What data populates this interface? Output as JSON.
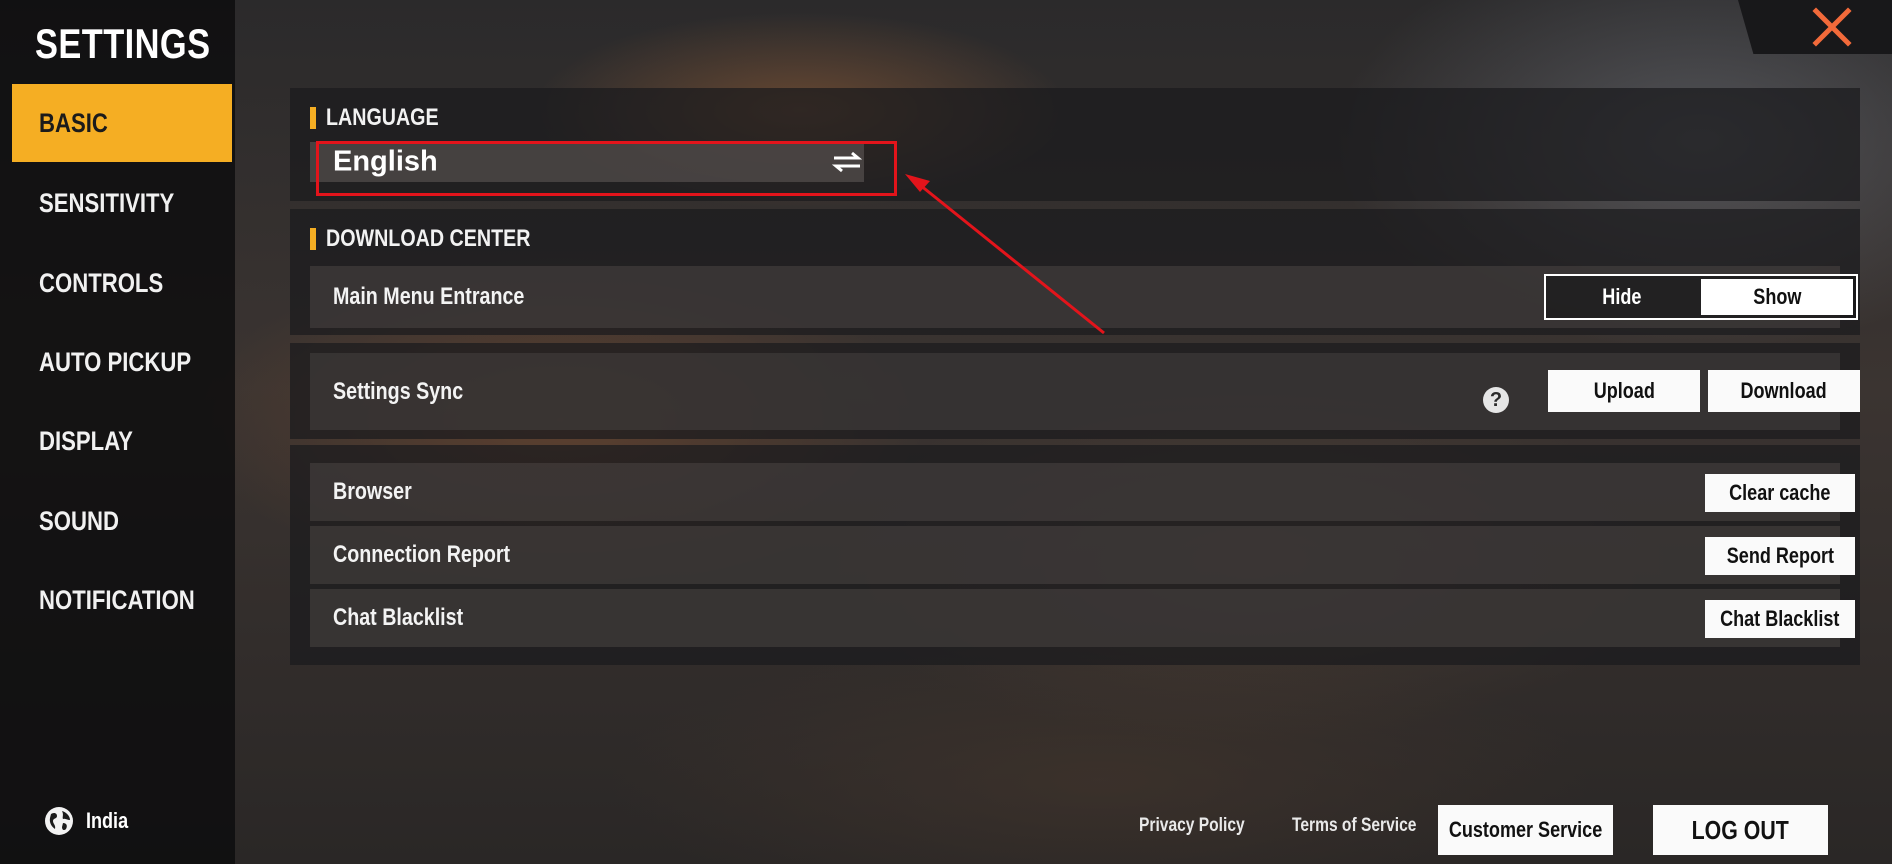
{
  "sidebar": {
    "title": "SETTINGS",
    "items": [
      {
        "label": "BASIC",
        "active": true
      },
      {
        "label": "SENSITIVITY",
        "active": false
      },
      {
        "label": "CONTROLS",
        "active": false
      },
      {
        "label": "AUTO PICKUP",
        "active": false
      },
      {
        "label": "DISPLAY",
        "active": false
      },
      {
        "label": "SOUND",
        "active": false
      },
      {
        "label": "NOTIFICATION",
        "active": false
      }
    ],
    "region": "India"
  },
  "language": {
    "section_label": "LANGUAGE",
    "value": "English"
  },
  "download_center": {
    "section_label": "DOWNLOAD CENTER",
    "row_label": "Main Menu Entrance",
    "options": [
      "Hide",
      "Show"
    ],
    "selected": "Show"
  },
  "sync": {
    "label": "Settings Sync",
    "help_glyph": "?",
    "upload_label": "Upload",
    "download_label": "Download"
  },
  "misc_rows": [
    {
      "label": "Browser",
      "button": "Clear cache"
    },
    {
      "label": "Connection Report",
      "button": "Send Report"
    },
    {
      "label": "Chat Blacklist",
      "button": "Chat Blacklist"
    }
  ],
  "footer": {
    "privacy": "Privacy Policy",
    "terms": "Terms of Service",
    "customer_service": "Customer Service",
    "logout": "LOG OUT"
  },
  "colors": {
    "accent": "#f5ae23",
    "close_icon": "#f26a3a",
    "annotation": "#e3141b"
  },
  "icons": {
    "close": "close-icon",
    "swap": "swap-arrows-icon",
    "help": "help-circle-icon",
    "globe": "globe-icon"
  }
}
